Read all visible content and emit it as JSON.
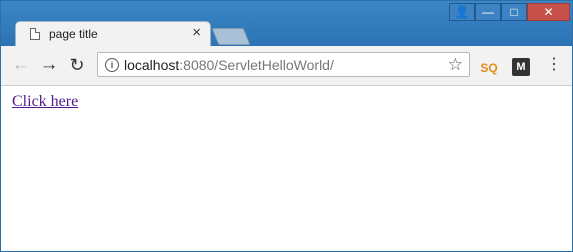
{
  "tab": {
    "title": "page title",
    "close": "×"
  },
  "controls": {
    "user": "👤",
    "minimize": "—",
    "maximize": "□",
    "close": "✕"
  },
  "nav": {
    "back": "←",
    "forward": "→",
    "reload": "↻"
  },
  "address": {
    "host": "localhost",
    "path": ":8080/ServletHelloWorld/"
  },
  "icons": {
    "info": "i",
    "star": "☆",
    "extension1": "SQ",
    "extension2": "M",
    "menu": "⋮"
  },
  "page": {
    "link": "Click here"
  }
}
